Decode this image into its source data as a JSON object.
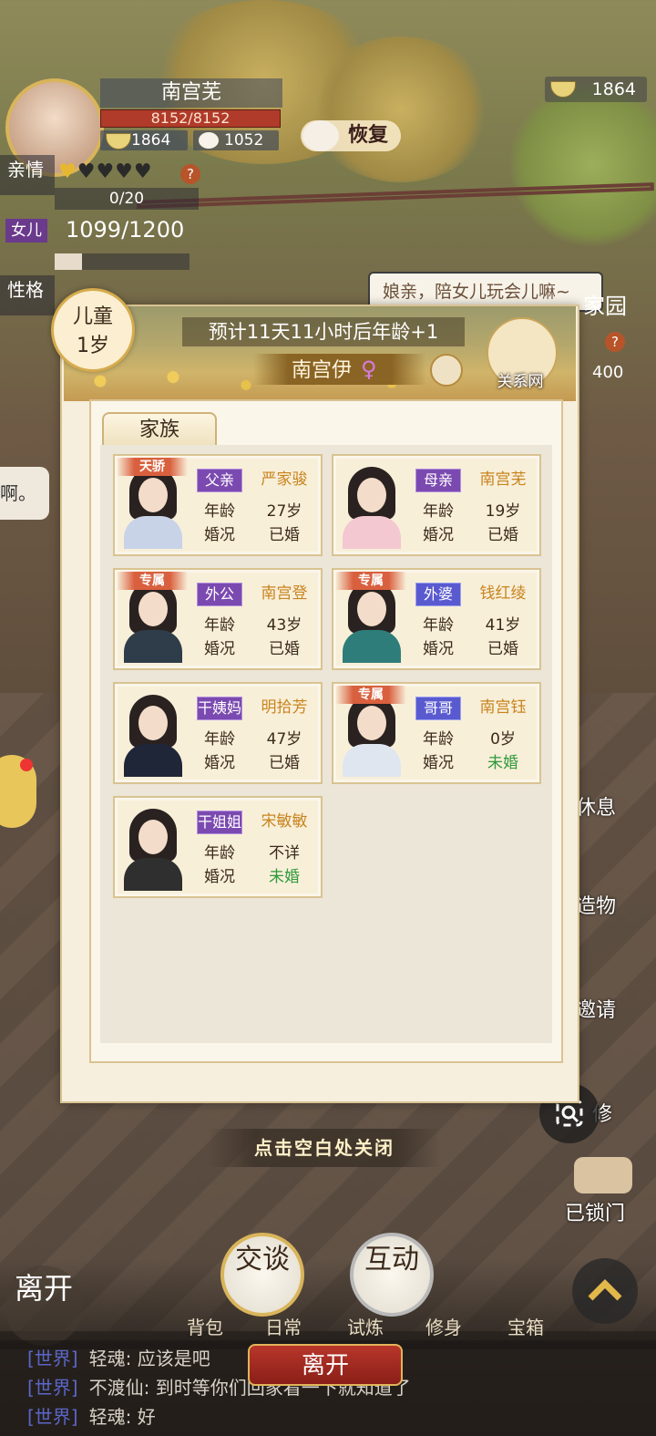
{
  "player": {
    "name": "南宫芜",
    "hp": "8152/8152",
    "food": "1864",
    "steamed_bun": "1052",
    "restore_label": "恢复",
    "kinship_label": "亲情",
    "kinship_progress": "0/20",
    "daughter_tag": "女儿",
    "daughter_value": "1099/1200",
    "personality_label": "性格"
  },
  "top_currency": "1864",
  "scene": {
    "speech": "娘亲，陪女儿玩会儿嘛~",
    "homeland": "家园",
    "mini_value": "400",
    "left_bubble": "啊。",
    "right_menu": [
      "休息",
      "造物",
      "邀请",
      "修"
    ],
    "locked_label": "已锁门"
  },
  "child_panel": {
    "age_stage": "儿童",
    "age": "1岁",
    "timer": "预计11天11小时后年龄+1",
    "name": "南宫伊",
    "gender_symbol": "♀",
    "relation_network": "关系网",
    "tab_family": "家族",
    "labels": {
      "age": "年龄",
      "marriage": "婚况"
    },
    "family": [
      {
        "badge": "天骄",
        "relation": "父亲",
        "name": "严家骏",
        "age": "27岁",
        "marriage": "已婚",
        "married": true
      },
      {
        "badge": "",
        "relation": "母亲",
        "name": "南宫芜",
        "age": "19岁",
        "marriage": "已婚",
        "married": true
      },
      {
        "badge": "专属",
        "relation": "外公",
        "name": "南宫登",
        "age": "43岁",
        "marriage": "已婚",
        "married": true
      },
      {
        "badge": "专属",
        "relation": "外婆",
        "name": "钱红绫",
        "age": "41岁",
        "marriage": "已婚",
        "married": true
      },
      {
        "badge": "",
        "relation": "干姨妈",
        "name": "明拾芳",
        "age": "47岁",
        "marriage": "已婚",
        "married": true
      },
      {
        "badge": "专属",
        "relation": "哥哥",
        "name": "南宫钰",
        "age": "0岁",
        "marriage": "未婚",
        "married": false
      },
      {
        "badge": "",
        "relation": "干姐姐",
        "name": "宋敏敏",
        "age": "不详",
        "marriage": "未婚",
        "married": false
      }
    ],
    "close_hint": "点击空白处关闭"
  },
  "bottom": {
    "leave_round": "离开",
    "talk": "交谈",
    "interact": "互动",
    "menu": [
      "背包",
      "日常",
      "试炼",
      "修身",
      "宝箱"
    ],
    "leave_button": "离开"
  },
  "chat": [
    {
      "channel": "[世界]",
      "text": "轻魂: 应该是吧"
    },
    {
      "channel": "[世界]",
      "text": "不渡仙: 到时等你们回家看一下就知道了"
    },
    {
      "channel": "[世界]",
      "text": "轻魂: 好"
    }
  ],
  "colors": {
    "gold": "#d9b45a",
    "purple_tag": "#7b4ab0",
    "married_green": "#2f9a3a",
    "name_orange": "#c8841e"
  }
}
